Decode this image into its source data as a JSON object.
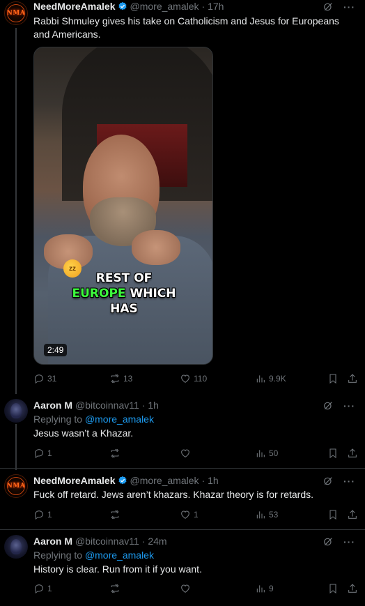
{
  "colors": {
    "background": "#000000",
    "text": "#e7e9ea",
    "muted": "#71767b",
    "link": "#1d9bf0",
    "verified": "#1d9bf0",
    "caption_highlight": "#3dfc3d"
  },
  "posts": [
    {
      "author": "NeedMoreAmalek",
      "handle": "@more_amalek",
      "time": "· 17h",
      "avatar_text": "NMA",
      "verified": true,
      "text": "Rabbi Shmuley gives his take on Catholicism and Jesus for Europeans and Americans.",
      "video": {
        "duration": "2:49",
        "caption_line1": "REST OF",
        "caption_green": "EUROPE",
        "caption_line2_rest": " WHICH",
        "caption_line3": "HAS"
      },
      "stats": {
        "replies": "31",
        "reposts": "13",
        "likes": "110",
        "views": "9.9K"
      }
    },
    {
      "author": "Aaron M",
      "handle": "@bitcoinnav11",
      "time": "· 1h",
      "replying_label": "Replying to",
      "replying_to": "@more_amalek",
      "text": "Jesus wasn’t a Khazar.",
      "stats": {
        "replies": "1",
        "reposts": "",
        "likes": "",
        "views": "50"
      }
    },
    {
      "author": "NeedMoreAmalek",
      "handle": "@more_amalek",
      "time": "· 1h",
      "avatar_text": "NMA",
      "verified": true,
      "text": "Fuck off retard. Jews aren’t khazars. Khazar theory is for retards.",
      "stats": {
        "replies": "1",
        "reposts": "",
        "likes": "1",
        "views": "53"
      }
    },
    {
      "author": "Aaron M",
      "handle": "@bitcoinnav11",
      "time": "· 24m",
      "replying_label": "Replying to",
      "replying_to": "@more_amalek",
      "text": "History is clear. Run from it if you want.",
      "stats": {
        "replies": "1",
        "reposts": "",
        "likes": "",
        "views": "9"
      }
    }
  ]
}
